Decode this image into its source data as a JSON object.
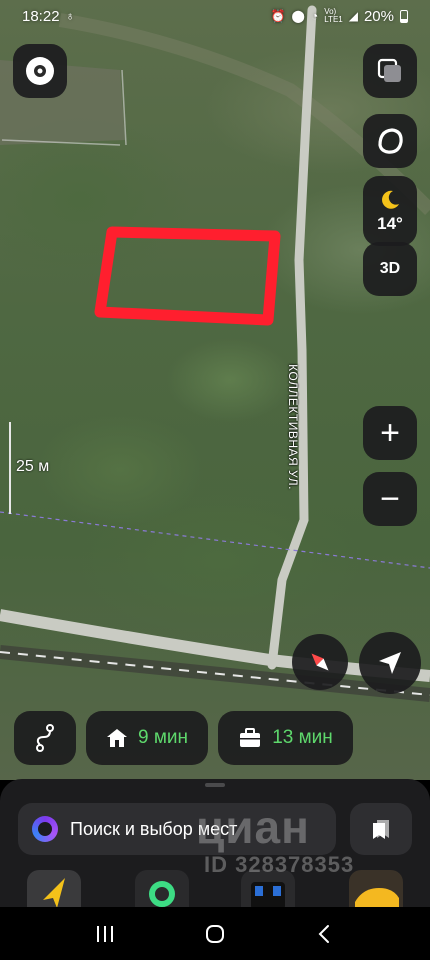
{
  "status_bar": {
    "time": "18:22",
    "battery": "20%",
    "signal_label": "VoLTE LTE1"
  },
  "map": {
    "street_name": "КОЛЛЕКТИВНАЯ УЛ.",
    "scale_label": "25 м",
    "marked_area_color": "#ff1f2e"
  },
  "controls": {
    "weather_temp": "14°",
    "mode_3d": "3D",
    "zoom_in": "+",
    "zoom_out": "−"
  },
  "quick_routes": {
    "home_time": "9 мин",
    "work_time": "13 мин"
  },
  "search": {
    "placeholder": "Поиск и выбор мест"
  },
  "watermark": {
    "brand": "циан",
    "id_text": "ID 328378353"
  },
  "colors": {
    "accent_green": "#5ed86c",
    "panel_bg": "#1c1c1e"
  }
}
